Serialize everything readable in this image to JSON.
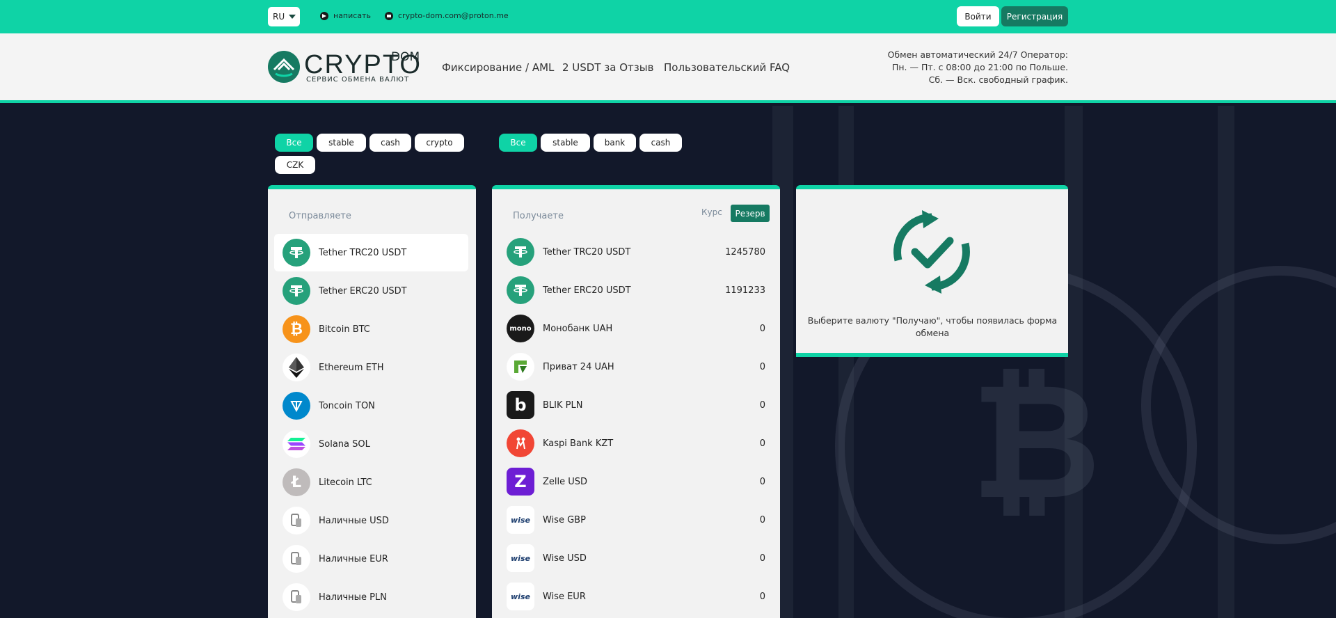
{
  "topbar": {
    "lang": "RU",
    "telegram_label": "написать",
    "email": "crypto-dom.com@proton.me",
    "login_label": "Войти",
    "register_label": "Регистрация"
  },
  "header": {
    "logo_main": "CRYPTO",
    "logo_dom": "DOM",
    "logo_sub": "СЕРВИС ОБМЕНА ВАЛЮТ",
    "nav": [
      "Фиксирование / AML",
      "2 USDT за Отзыв",
      "Пользовательский FAQ"
    ],
    "schedule": [
      "Обмен автоматический 24/7 Оператор:",
      "Пн. — Пт. с 08:00 до 21:00 по Польше.",
      "Сб. — Вск. свободный график."
    ]
  },
  "filters_send": [
    "Все",
    "stable",
    "cash",
    "crypto",
    "CZK"
  ],
  "filters_receive": [
    "Все",
    "stable",
    "bank",
    "cash"
  ],
  "send_panel": {
    "title": "Отправляете",
    "items": [
      {
        "name": "Tether TRC20 USDT",
        "icon": "tether-icon"
      },
      {
        "name": "Tether ERC20 USDT",
        "icon": "tether-icon"
      },
      {
        "name": "Bitcoin BTC",
        "icon": "bitcoin-icon"
      },
      {
        "name": "Ethereum ETH",
        "icon": "ethereum-icon"
      },
      {
        "name": "Toncoin TON",
        "icon": "toncoin-icon"
      },
      {
        "name": "Solana SOL",
        "icon": "solana-icon"
      },
      {
        "name": "Litecoin LTC",
        "icon": "litecoin-icon"
      },
      {
        "name": "Наличные USD",
        "icon": "cash-icon"
      },
      {
        "name": "Наличные EUR",
        "icon": "cash-icon"
      },
      {
        "name": "Наличные PLN",
        "icon": "cash-icon"
      }
    ]
  },
  "receive_panel": {
    "title": "Получаете",
    "kurs_label": "Курс",
    "reserve_label": "Резерв",
    "items": [
      {
        "name": "Tether TRC20 USDT",
        "amount": "1245780",
        "icon": "tether-icon"
      },
      {
        "name": "Tether ERC20 USDT",
        "amount": "1191233",
        "icon": "tether-icon"
      },
      {
        "name": "Монобанк UAH",
        "amount": "0",
        "icon": "monobank-icon",
        "icon_text": "mono"
      },
      {
        "name": "Приват 24 UAH",
        "amount": "0",
        "icon": "privat24-icon"
      },
      {
        "name": "BLIK PLN",
        "amount": "0",
        "icon": "blik-icon",
        "icon_text": "b"
      },
      {
        "name": "Kaspi Bank KZT",
        "amount": "0",
        "icon": "kaspi-icon"
      },
      {
        "name": "Zelle USD",
        "amount": "0",
        "icon": "zelle-icon",
        "icon_text": "Z"
      },
      {
        "name": "Wise GBP",
        "amount": "0",
        "icon": "wise-icon",
        "icon_text": "wise"
      },
      {
        "name": "Wise USD",
        "amount": "0",
        "icon": "wise-icon",
        "icon_text": "wise"
      },
      {
        "name": "Wise EUR",
        "amount": "0",
        "icon": "wise-icon",
        "icon_text": "wise"
      }
    ]
  },
  "info_panel": {
    "hint": "Выберите валюту \"Получаю\", чтобы появилась форма обмена",
    "icon": "exchange-check-icon"
  },
  "colors": {
    "accent": "#0fd3a6",
    "dark_green": "#167a62",
    "background": "#12182a"
  }
}
